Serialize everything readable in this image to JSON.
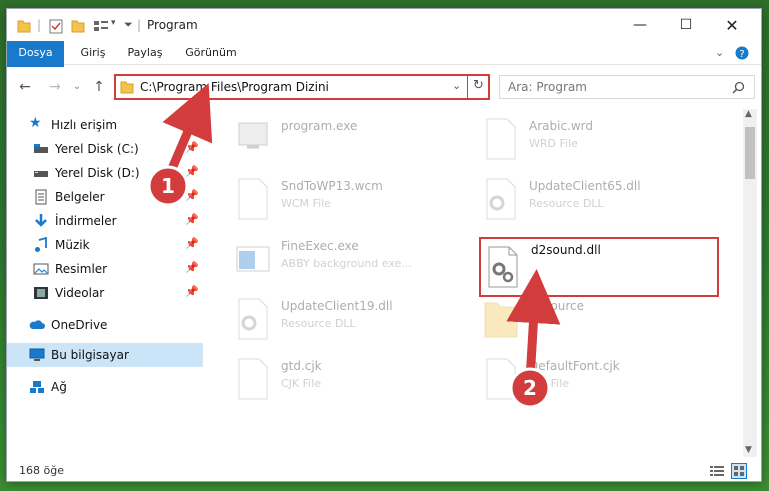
{
  "window": {
    "title": "Program"
  },
  "ribbon": {
    "tabs": [
      "Dosya",
      "Giriş",
      "Paylaş",
      "Görünüm"
    ]
  },
  "address": {
    "path": "C:\\Program Files\\Program Dizini"
  },
  "search": {
    "placeholder": "Ara: Program"
  },
  "nav": {
    "quick_access": "Hızlı erişim",
    "items": [
      {
        "label": "Yerel Disk (C:)",
        "icon": "drive-icon"
      },
      {
        "label": "Yerel Disk (D:)",
        "icon": "drive-icon"
      },
      {
        "label": "Belgeler",
        "icon": "documents-icon"
      },
      {
        "label": "İndirmeler",
        "icon": "download-icon"
      },
      {
        "label": "Müzik",
        "icon": "music-icon"
      },
      {
        "label": "Resimler",
        "icon": "pictures-icon"
      },
      {
        "label": "Videolar",
        "icon": "videos-icon"
      }
    ],
    "onedrive": "OneDrive",
    "this_pc": "Bu bilgisayar",
    "network": "Ağ"
  },
  "files": [
    {
      "name": "program.exe",
      "type": "",
      "faded": true
    },
    {
      "name": "Arabic.wrd",
      "type": "WRD File",
      "faded": true
    },
    {
      "name": "SndToWP13.wcm",
      "type": "WCM File",
      "faded": true
    },
    {
      "name": "UpdateClient65.dll",
      "type": "Resource DLL",
      "faded": true
    },
    {
      "name": "FineExec.exe",
      "type": "ABBY background exe...",
      "faded": true
    },
    {
      "name": "d2sound.dll",
      "type": "",
      "faded": false
    },
    {
      "name": "UpdateClient19.dll",
      "type": "Resource DLL",
      "faded": true
    },
    {
      "name": "Resource",
      "type": "",
      "faded": true
    },
    {
      "name": "gtd.cjk",
      "type": "CJK File",
      "faded": true
    },
    {
      "name": "DefaultFont.cjk",
      "type": "CJK File",
      "faded": true
    }
  ],
  "status": {
    "count": "168 öğe"
  },
  "annotations": {
    "step1": "1",
    "step2": "2",
    "color": "#d23c3c"
  }
}
